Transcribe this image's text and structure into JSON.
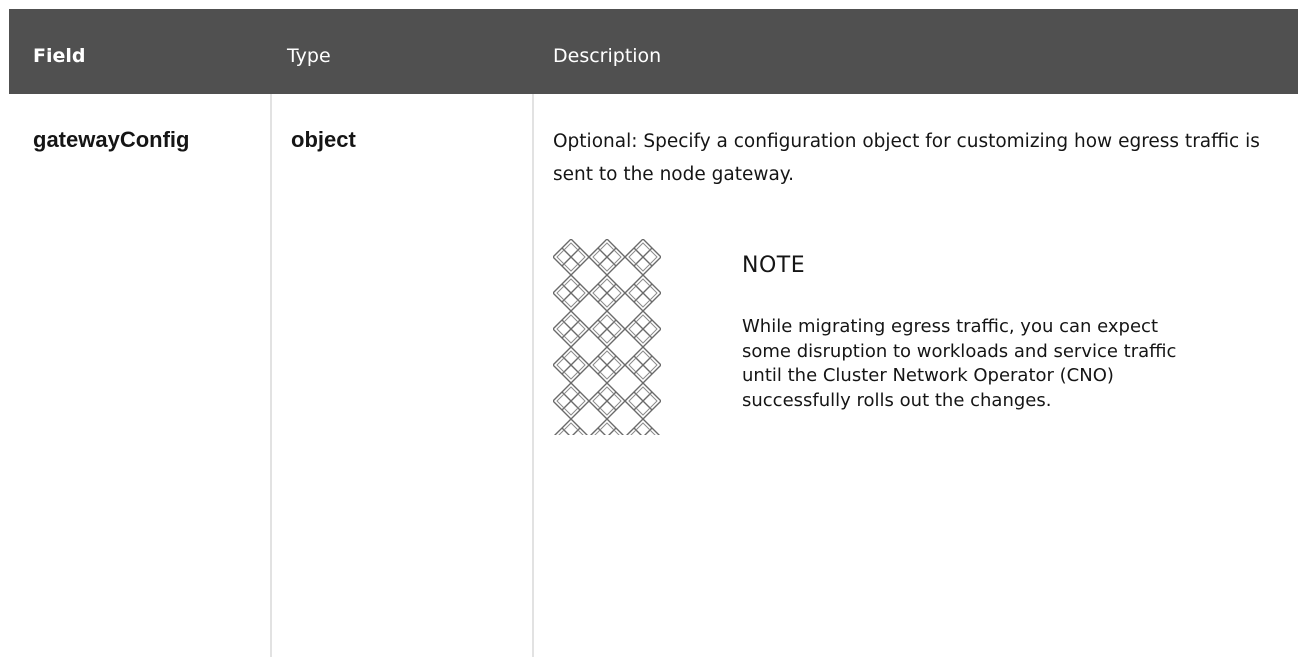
{
  "table": {
    "headers": {
      "field": "Field",
      "type": "Type",
      "description": "Description"
    },
    "rows": [
      {
        "field": "gatewayConfig",
        "type": "object",
        "description": "Optional: Specify a configuration object for customizing how egress traffic is sent to the node gateway.",
        "note": {
          "icon": "note-pattern-icon",
          "title": "NOTE",
          "text": "While migrating egress traffic, you can expect some disruption to workloads and service traffic until the Cluster Network Operator (CNO) successfully rolls out the changes."
        }
      }
    ]
  },
  "colors": {
    "header_bg": "#505050",
    "header_text": "#ffffff",
    "divider": "#e2e2e2",
    "text": "#151515"
  }
}
